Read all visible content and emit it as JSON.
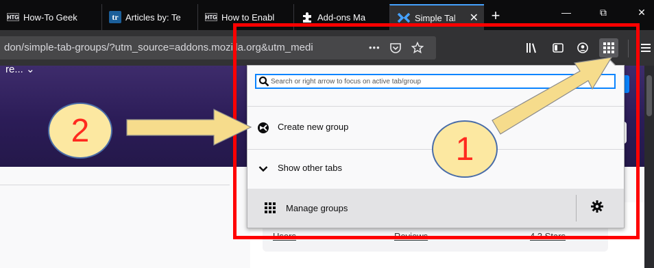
{
  "browser": {
    "tabs": [
      {
        "favicon": "HTG",
        "title": "How-To Geek"
      },
      {
        "favicon": "tr",
        "title": "Articles by: Te"
      },
      {
        "favicon": "HTG",
        "title": "How to Enabl"
      },
      {
        "favicon": "puzzle-piece-icon",
        "title": "Add-ons Ma"
      },
      {
        "favicon": "simple-tab-groups-icon",
        "title": "Simple Tal",
        "active": true
      }
    ],
    "new_tab_label": "+",
    "window_controls": {
      "minimize": "—",
      "restore": "⧉",
      "close": "✕"
    },
    "tab_close": "✕",
    "url": "don/simple-tab-groups/?utm_source=addons.mozilla.org&utm_medi",
    "url_actions": [
      "page-actions-icon",
      "pocket-icon",
      "star-icon"
    ],
    "page_actions_label": "•••",
    "toolbar_icons": [
      "library-icon",
      "sidebar-icon",
      "account-icon",
      "simple-tab-groups-icon",
      "menu-icon"
    ]
  },
  "page": {
    "hero_text": "re... ⌄",
    "stats": [
      "Users",
      "Reviews",
      "4.3 Stars"
    ]
  },
  "popup": {
    "search_placeholder": "Search or right arrow to focus on active tab/group",
    "create_new_group": "Create new group",
    "show_other_tabs": "Show other tabs",
    "manage_groups": "Manage groups"
  },
  "annotations": {
    "callout_1": "1",
    "callout_2": "2",
    "colors": {
      "box": "#ff0000",
      "circle_fill": "#fce8a1",
      "number": "#ff2a1f",
      "arrow_fill": "#f6dc8c"
    }
  }
}
